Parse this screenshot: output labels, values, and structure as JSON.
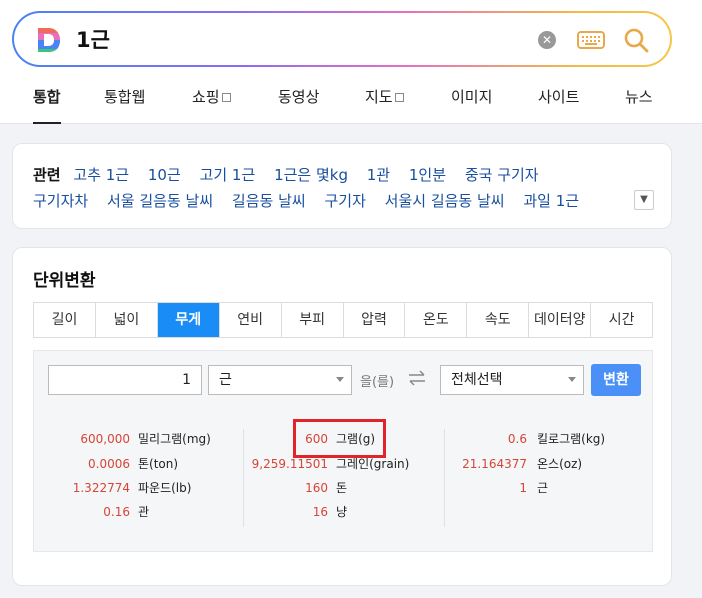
{
  "search": {
    "query": "1근",
    "logo_icon": "daum-d-logo"
  },
  "tabs": [
    {
      "label": "통합",
      "active": true
    },
    {
      "label": "통합웹"
    },
    {
      "label": "쇼핑"
    },
    {
      "label": "동영상"
    },
    {
      "label": "지도"
    },
    {
      "label": "이미지"
    },
    {
      "label": "사이트"
    },
    {
      "label": "뉴스"
    }
  ],
  "related": {
    "title": "관련",
    "line1": [
      "고추 1근",
      "10근",
      "고기 1근",
      "1근은 몇kg",
      "1관",
      "1인분",
      "중국 구기자"
    ],
    "line2": [
      "구기자차",
      "서울 길음동 날씨",
      "길음동 날씨",
      "구기자",
      "서울시 길음동 날씨",
      "과일 1근"
    ]
  },
  "converter": {
    "title": "단위변환",
    "unit_tabs": [
      "길이",
      "넓이",
      "무게",
      "연비",
      "부피",
      "압력",
      "온도",
      "속도",
      "데이터양",
      "시간"
    ],
    "active_tab": "무게",
    "input_value": "1",
    "from_unit": "근",
    "eul_label": "을(를)",
    "to_unit": "전체선택",
    "convert_label": "변환",
    "results": {
      "col1": [
        {
          "value": "600,000",
          "unit": "밀리그램(mg)"
        },
        {
          "value": "0.0006",
          "unit": "톤(ton)"
        },
        {
          "value": "1.322774",
          "unit": "파운드(lb)"
        },
        {
          "value": "0.16",
          "unit": "관"
        }
      ],
      "col2": [
        {
          "value": "600",
          "unit": "그램(g)"
        },
        {
          "value": "9,259.11501",
          "unit": "그레인(grain)"
        },
        {
          "value": "160",
          "unit": "돈"
        },
        {
          "value": "16",
          "unit": "냥"
        }
      ],
      "col3": [
        {
          "value": "0.6",
          "unit": "킬로그램(kg)"
        },
        {
          "value": "21.164377",
          "unit": "온스(oz)"
        },
        {
          "value": "1",
          "unit": "근"
        }
      ]
    }
  },
  "colors": {
    "accent": "#1a8cf6",
    "result_value": "#d64536",
    "highlight": "#e0242a"
  }
}
